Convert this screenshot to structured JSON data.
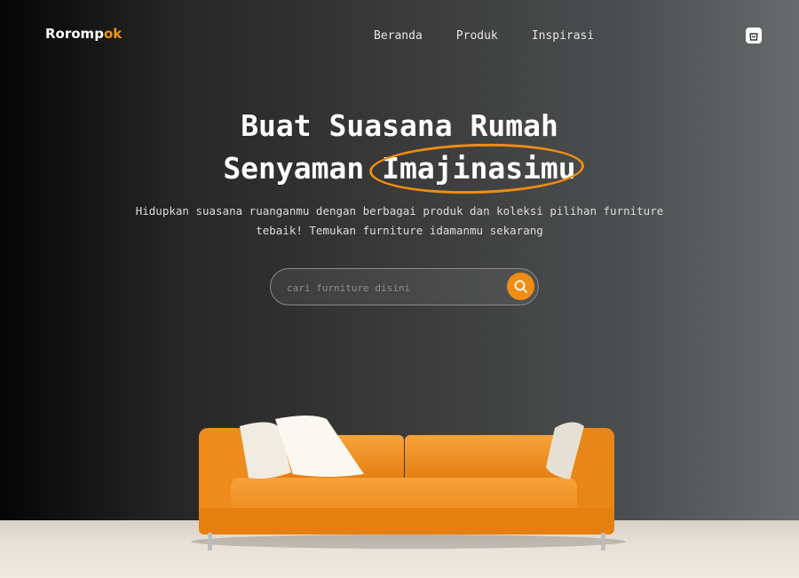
{
  "navbar": {
    "logo_main": "Rorompok",
    "logo_accent": "",
    "links": [
      "Beranda",
      "Produk",
      "Inspirasi"
    ],
    "cart_icon": "shopping-bag-icon"
  },
  "hero": {
    "title_line1": "Buat Suasana Rumah",
    "title_line2_prefix": "Senyaman ",
    "title_highlight": "Imajinasimu",
    "subtitle": "Hidupkan suasana ruanganmu dengan berbagai produk dan koleksi pilihan furniture tebaik! Temukan furniture idamanmu sekarang",
    "accent_color": "#f08d12"
  },
  "search": {
    "placeholder": "cari furniture disini",
    "button_icon": "search-icon"
  }
}
